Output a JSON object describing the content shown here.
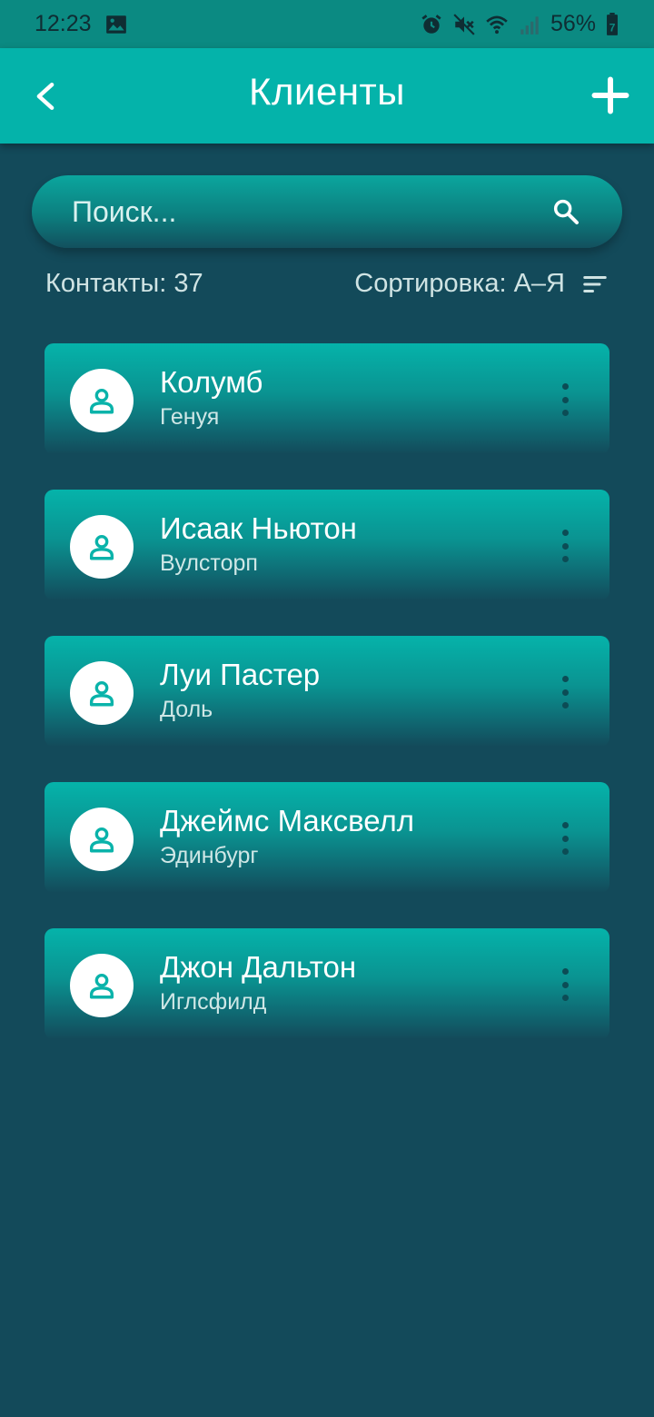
{
  "status_bar": {
    "time": "12:23",
    "battery_percent": "56%",
    "battery_level": "7",
    "icons": [
      "image-icon",
      "alarm-icon",
      "mute-icon",
      "wifi-icon",
      "signal-icon",
      "battery-icon"
    ]
  },
  "app_bar": {
    "title": "Клиенты",
    "back_icon": "chevron-left-icon",
    "add_icon": "plus-icon"
  },
  "search": {
    "placeholder": "Поиск...",
    "value": "",
    "icon": "search-icon"
  },
  "meta": {
    "contacts_label": "Контакты: 37",
    "sort_label": "Сортировка: А–Я",
    "sort_icon": "sort-icon"
  },
  "clients": [
    {
      "name": "Колумб",
      "city": "Генуя"
    },
    {
      "name": "Исаак Ньютон",
      "city": "Вулсторп"
    },
    {
      "name": "Луи Пастер",
      "city": "Доль"
    },
    {
      "name": "Джеймс Максвелл",
      "city": "Эдинбург"
    },
    {
      "name": "Джон Дальтон",
      "city": "Иглсфилд"
    }
  ],
  "colors": {
    "background": "#134a5a",
    "status_bar": "#0b8a82",
    "app_bar": "#04b3aa",
    "accent": "#0ab3aa",
    "text_primary": "#ffffff"
  }
}
